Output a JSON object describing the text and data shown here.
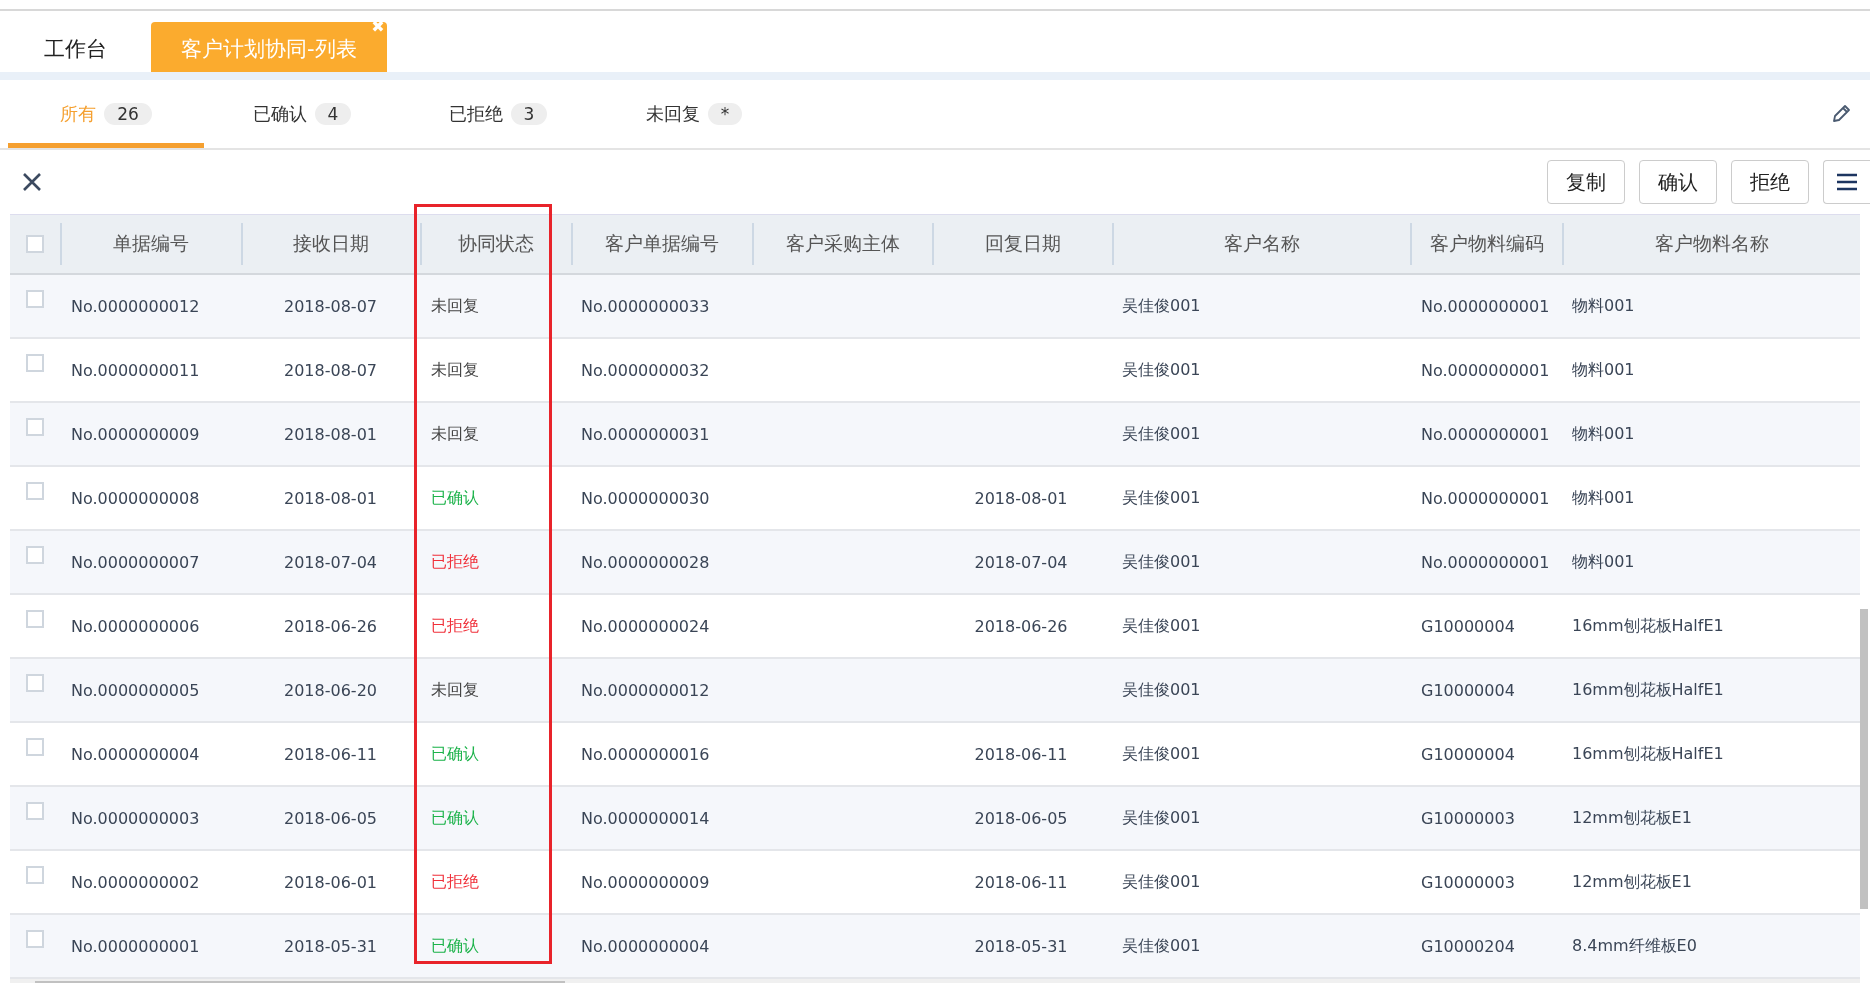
{
  "page_tabs": [
    {
      "label": "工作台",
      "selected": false
    },
    {
      "label": "客户计划协同-列表",
      "selected": true,
      "close": "✖"
    }
  ],
  "filter_tabs": [
    {
      "label": "所有",
      "count": "26",
      "selected": true
    },
    {
      "label": "已确认",
      "count": "4",
      "selected": false
    },
    {
      "label": "已拒绝",
      "count": "3",
      "selected": false
    },
    {
      "label": "未回复",
      "count": "*",
      "selected": false
    }
  ],
  "toolbar": {
    "buttons": [
      "复制",
      "确认",
      "拒绝"
    ]
  },
  "table": {
    "select_all_checked": false,
    "columns": [
      "单据编号",
      "接收日期",
      "协同状态",
      "客户单据编号",
      "客户采购主体",
      "回复日期",
      "客户名称",
      "客户物料编码",
      "客户物料名称"
    ],
    "rows": [
      {
        "checked": false,
        "cells": [
          "No.0000000012",
          "2018-08-07",
          {
            "text": "未回复",
            "kind": "pending"
          },
          "No.0000000033",
          "",
          "",
          "吴佳俊001",
          "No.0000000001",
          "物料001"
        ]
      },
      {
        "checked": false,
        "cells": [
          "No.0000000011",
          "2018-08-07",
          {
            "text": "未回复",
            "kind": "pending"
          },
          "No.0000000032",
          "",
          "",
          "吴佳俊001",
          "No.0000000001",
          "物料001"
        ]
      },
      {
        "checked": false,
        "cells": [
          "No.0000000009",
          "2018-08-01",
          {
            "text": "未回复",
            "kind": "pending"
          },
          "No.0000000031",
          "",
          "",
          "吴佳俊001",
          "No.0000000001",
          "物料001"
        ]
      },
      {
        "checked": false,
        "cells": [
          "No.0000000008",
          "2018-08-01",
          {
            "text": "已确认",
            "kind": "confirmed"
          },
          "No.0000000030",
          "",
          "2018-08-01",
          "吴佳俊001",
          "No.0000000001",
          "物料001"
        ]
      },
      {
        "checked": false,
        "cells": [
          "No.0000000007",
          "2018-07-04",
          {
            "text": "已拒绝",
            "kind": "rejected"
          },
          "No.0000000028",
          "",
          "2018-07-04",
          "吴佳俊001",
          "No.0000000001",
          "物料001"
        ]
      },
      {
        "checked": false,
        "cells": [
          "No.0000000006",
          "2018-06-26",
          {
            "text": "已拒绝",
            "kind": "rejected"
          },
          "No.0000000024",
          "",
          "2018-06-26",
          "吴佳俊001",
          "G10000004",
          "16mm刨花板HalfE1"
        ]
      },
      {
        "checked": false,
        "cells": [
          "No.0000000005",
          "2018-06-20",
          {
            "text": "未回复",
            "kind": "pending"
          },
          "No.0000000012",
          "",
          "",
          "吴佳俊001",
          "G10000004",
          "16mm刨花板HalfE1"
        ]
      },
      {
        "checked": false,
        "cells": [
          "No.0000000004",
          "2018-06-11",
          {
            "text": "已确认",
            "kind": "confirmed"
          },
          "No.0000000016",
          "",
          "2018-06-11",
          "吴佳俊001",
          "G10000004",
          "16mm刨花板HalfE1"
        ]
      },
      {
        "checked": false,
        "cells": [
          "No.0000000003",
          "2018-06-05",
          {
            "text": "已确认",
            "kind": "confirmed"
          },
          "No.0000000014",
          "",
          "2018-06-05",
          "吴佳俊001",
          "G10000003",
          "12mm刨花板E1"
        ]
      },
      {
        "checked": false,
        "cells": [
          "No.0000000002",
          "2018-06-01",
          {
            "text": "已拒绝",
            "kind": "rejected"
          },
          "No.0000000009",
          "",
          "2018-06-11",
          "吴佳俊001",
          "G10000003",
          "12mm刨花板E1"
        ]
      },
      {
        "checked": false,
        "cells": [
          "No.0000000001",
          "2018-05-31",
          {
            "text": "已确认",
            "kind": "confirmed"
          },
          "No.0000000004",
          "",
          "2018-05-31",
          "吴佳俊001",
          "G10000204",
          "8.4mm纤维板E0"
        ]
      }
    ]
  }
}
